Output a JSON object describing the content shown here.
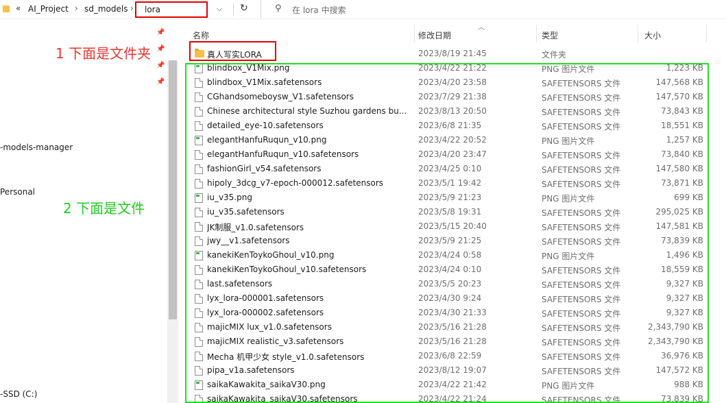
{
  "addressbar": {
    "chevrons": "«",
    "crumbs": [
      "AI_Project",
      "sd_models"
    ],
    "separator": "›",
    "current": "lora",
    "dropdown_icon": "chevron-down-icon",
    "refresh_icon": "refresh-icon"
  },
  "search": {
    "placeholder": "在 lora 中搜索",
    "icon": "search-icon"
  },
  "nav": {
    "items": [
      {
        "label": "-models-manager"
      },
      {
        "label": " Personal"
      },
      {
        "label": "-SSD (C:)"
      }
    ]
  },
  "annotations": {
    "folders_note": "1 下面是文件夹",
    "files_note": "2 下面是文件"
  },
  "columns": {
    "name": "名称",
    "date": "修改日期",
    "type": "类型",
    "size": "大小"
  },
  "files": [
    {
      "icon": "folder-icon",
      "name": "真人写实LORA",
      "date": "2023/8/19 21:45",
      "type": "文件夹",
      "size": ""
    },
    {
      "icon": "image-file-icon",
      "name": "blindbox_V1Mix.png",
      "date": "2023/4/22 21:22",
      "type": "PNG 图片文件",
      "size": "1,223 KB"
    },
    {
      "icon": "file-icon",
      "name": "blindbox_V1Mix.safetensors",
      "date": "2023/4/20 23:58",
      "type": "SAFETENSORS 文件",
      "size": "147,568 KB"
    },
    {
      "icon": "file-icon",
      "name": "CGhandsomeboysw_V1.safetensors",
      "date": "2023/7/29 21:38",
      "type": "SAFETENSORS 文件",
      "size": "147,570 KB"
    },
    {
      "icon": "file-icon",
      "name": "Chinese architectural style Suzhou gardens     bu...",
      "date": "2023/8/13 20:50",
      "type": "SAFETENSORS 文件",
      "size": "73,843 KB"
    },
    {
      "icon": "file-icon",
      "name": "detailed_eye-10.safetensors",
      "date": "2023/6/8 21:35",
      "type": "SAFETENSORS 文件",
      "size": "18,551 KB"
    },
    {
      "icon": "image-file-icon",
      "name": "elegantHanfuRuqun_v10.png",
      "date": "2023/4/22 20:52",
      "type": "PNG 图片文件",
      "size": "1,257 KB"
    },
    {
      "icon": "file-icon",
      "name": "elegantHanfuRuqun_v10.safetensors",
      "date": "2023/4/20 23:47",
      "type": "SAFETENSORS 文件",
      "size": "73,840 KB"
    },
    {
      "icon": "file-icon",
      "name": "fashionGirl_v54.safetensors",
      "date": "2023/4/25 0:10",
      "type": "SAFETENSORS 文件",
      "size": "147,580 KB"
    },
    {
      "icon": "file-icon",
      "name": "hipoly_3dcg_v7-epoch-000012.safetensors",
      "date": "2023/5/1 19:42",
      "type": "SAFETENSORS 文件",
      "size": "73,871 KB"
    },
    {
      "icon": "image-file-icon",
      "name": "iu_v35.png",
      "date": "2023/5/9 21:23",
      "type": "PNG 图片文件",
      "size": "699 KB"
    },
    {
      "icon": "file-icon",
      "name": "iu_v35.safetensors",
      "date": "2023/5/8 19:31",
      "type": "SAFETENSORS 文件",
      "size": "295,025 KB"
    },
    {
      "icon": "file-icon",
      "name": "JK制服_v1.0.safetensors",
      "date": "2023/5/15 20:40",
      "type": "SAFETENSORS 文件",
      "size": "147,581 KB"
    },
    {
      "icon": "file-icon",
      "name": "jwy__v1.safetensors",
      "date": "2023/5/9 21:25",
      "type": "SAFETENSORS 文件",
      "size": "73,839 KB"
    },
    {
      "icon": "image-file-icon",
      "name": "kanekiKenToykoGhoul_v10.png",
      "date": "2023/4/24 0:58",
      "type": "PNG 图片文件",
      "size": "1,496 KB"
    },
    {
      "icon": "file-icon",
      "name": "kanekiKenToykoGhoul_v10.safetensors",
      "date": "2023/4/24 0:10",
      "type": "SAFETENSORS 文件",
      "size": "18,559 KB"
    },
    {
      "icon": "file-icon",
      "name": "last.safetensors",
      "date": "2023/5/5 20:23",
      "type": "SAFETENSORS 文件",
      "size": "9,327 KB"
    },
    {
      "icon": "file-icon",
      "name": "lyx_lora-000001.safetensors",
      "date": "2023/4/30 9:24",
      "type": "SAFETENSORS 文件",
      "size": "9,327 KB"
    },
    {
      "icon": "file-icon",
      "name": "lyx_lora-000002.safetensors",
      "date": "2023/4/30 21:33",
      "type": "SAFETENSORS 文件",
      "size": "9,327 KB"
    },
    {
      "icon": "file-icon",
      "name": "majicMIX lux_v1.0.safetensors",
      "date": "2023/5/16 21:28",
      "type": "SAFETENSORS 文件",
      "size": "2,343,790 KB"
    },
    {
      "icon": "file-icon",
      "name": "majicMIX realistic_v3.safetensors",
      "date": "2023/5/16 21:28",
      "type": "SAFETENSORS 文件",
      "size": "2,343,790 KB"
    },
    {
      "icon": "file-icon",
      "name": "Mecha 机甲少女 style_v1.0.safetensors",
      "date": "2023/6/8 22:59",
      "type": "SAFETENSORS 文件",
      "size": "36,976 KB"
    },
    {
      "icon": "file-icon",
      "name": "pipa_v1a.safetensors",
      "date": "2023/8/12 19:07",
      "type": "SAFETENSORS 文件",
      "size": "147,572 KB"
    },
    {
      "icon": "image-file-icon",
      "name": "saikaKawakita_saikaV30.png",
      "date": "2023/4/22 21:42",
      "type": "PNG 图片文件",
      "size": "988 KB"
    },
    {
      "icon": "file-icon",
      "name": "saikaKawakita_saikaV30.safetensors",
      "date": "2023/4/22 21:24",
      "type": "SAFETENSORS 文件",
      "size": "73,839 KB"
    }
  ],
  "colors": {
    "highlight_red": "#e00000",
    "highlight_green": "#22dd22",
    "annotation_red": "#e8362f",
    "annotation_green": "#20cc20"
  }
}
